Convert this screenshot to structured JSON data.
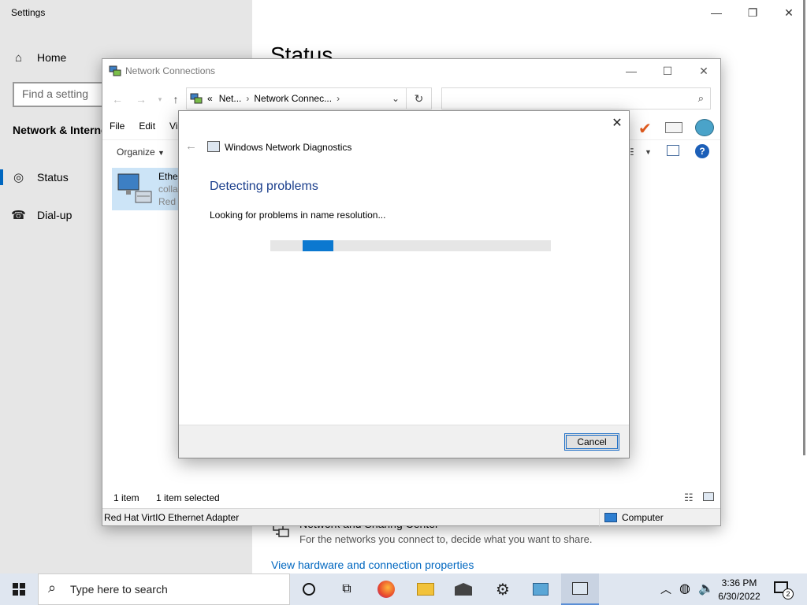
{
  "settings": {
    "title": "Settings",
    "nav_home": "Home",
    "search_placeholder": "Find a setting",
    "section": "Network & Internet",
    "items": [
      {
        "label": "Status"
      },
      {
        "label": "Dial-up"
      }
    ],
    "main_heading": "Status",
    "nsc_title": "Network and Sharing Center",
    "nsc_desc": "For the networks you connect to, decide what you want to share.",
    "view_hw_link": "View hardware and connection properties"
  },
  "netconn": {
    "title": "Network Connections",
    "address": {
      "chevrons": "«",
      "crumb1": "Net...",
      "crumb2": "Network Connec..."
    },
    "menu": [
      "File",
      "Edit",
      "Vie"
    ],
    "organize": "Organize",
    "item": {
      "name": "Ether",
      "line2": "colla",
      "line3": "Red I"
    },
    "status_count": "1 item",
    "status_selected": "1 item selected",
    "bottom_left": "Red Hat VirtIO Ethernet Adapter",
    "bottom_right": "Computer"
  },
  "diagnostics": {
    "title": "Windows Network Diagnostics",
    "heading": "Detecting problems",
    "message": "Looking for problems in name resolution...",
    "progress": 0.11,
    "cancel_label": "Cancel"
  },
  "taskbar": {
    "search_text": "Type here to search",
    "time": "3:36 PM",
    "date": "6/30/2022",
    "notification_count": "2"
  },
  "colors": {
    "accent": "#0067c0",
    "progress": "#0b78d0",
    "heading": "#1a3e8c"
  }
}
